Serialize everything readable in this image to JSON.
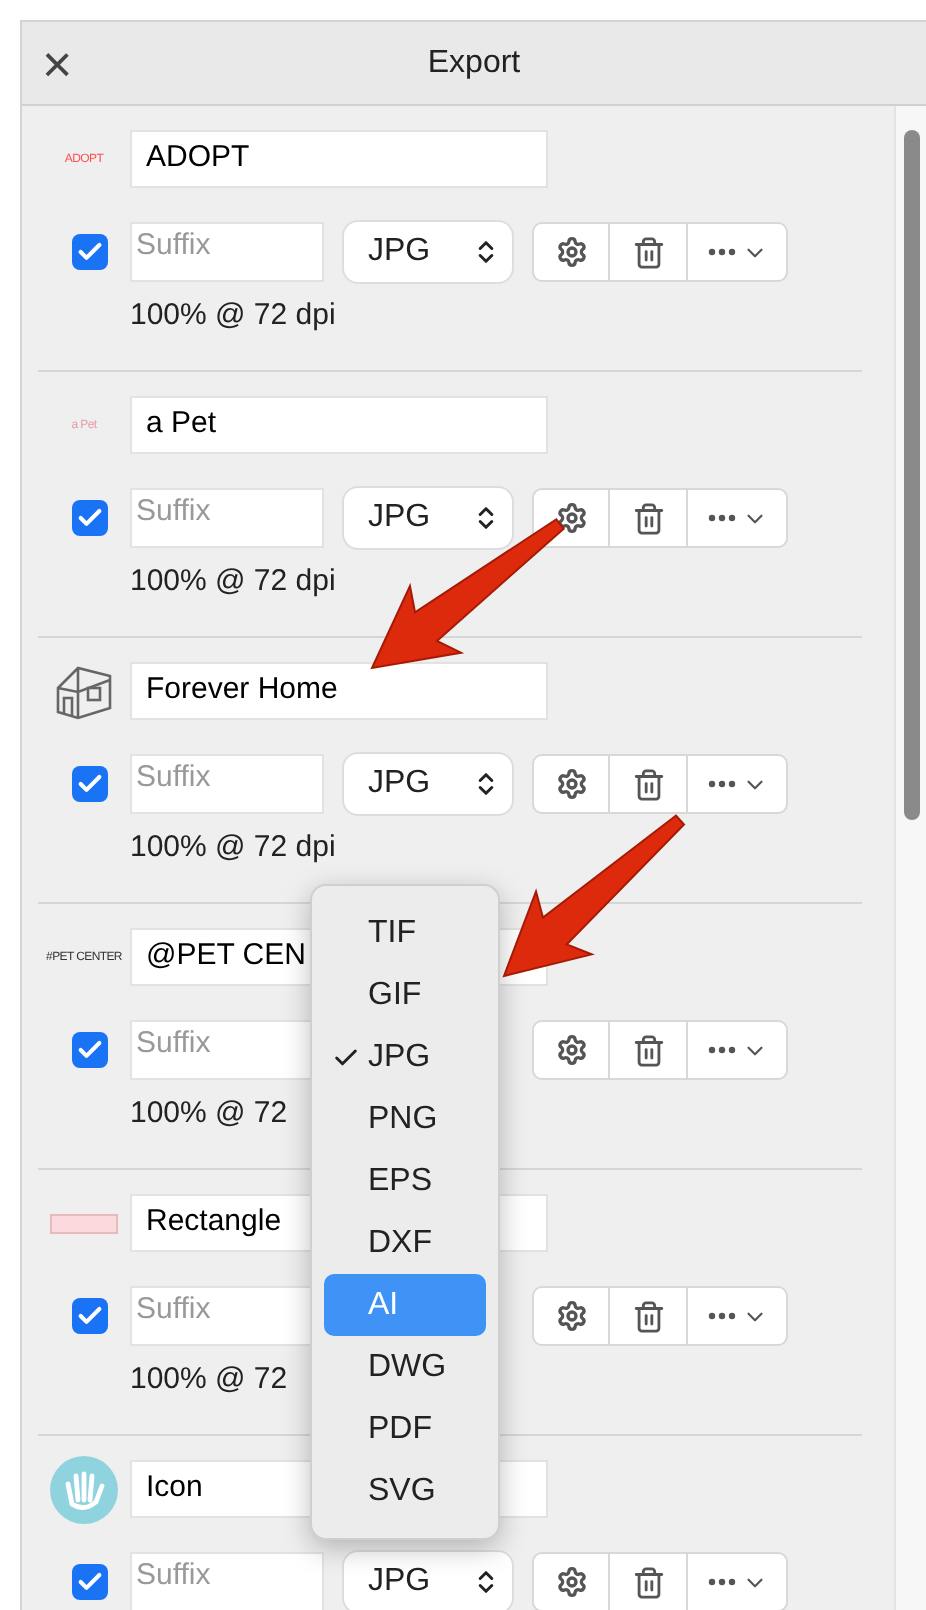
{
  "window": {
    "title": "Export",
    "close": "×"
  },
  "exports": [
    {
      "thumbnail": {
        "kind": "text",
        "text": "ADOPT",
        "color": "#ff4d4d"
      },
      "name": "ADOPT",
      "checked": true,
      "suffix_placeholder": "Suffix",
      "format": "JPG",
      "scale": "100% @ 72 dpi"
    },
    {
      "thumbnail": {
        "kind": "text",
        "text": "a Pet",
        "color": "#e79aa3"
      },
      "name": "a Pet",
      "checked": true,
      "suffix_placeholder": "Suffix",
      "format": "JPG",
      "scale": "100% @ 72 dpi"
    },
    {
      "thumbnail": {
        "kind": "house"
      },
      "name": "Forever Home",
      "checked": true,
      "suffix_placeholder": "Suffix",
      "format": "JPG",
      "scale": "100% @ 72 dpi"
    },
    {
      "thumbnail": {
        "kind": "text",
        "text": "#PET CENTER",
        "color": "#333333"
      },
      "name": "@PET CEN",
      "checked": true,
      "suffix_placeholder": "Suffix",
      "scale": "100% @ 72"
    },
    {
      "thumbnail": {
        "kind": "rect"
      },
      "name": "Rectangle",
      "checked": true,
      "suffix_placeholder": "Suffix",
      "scale": "100% @ 72"
    },
    {
      "thumbnail": {
        "kind": "hand"
      },
      "name": "Icon",
      "checked": true,
      "suffix_placeholder": "Suffix",
      "format": "JPG"
    }
  ],
  "format_menu": {
    "items": [
      {
        "label": "TIF",
        "selected": false,
        "highlighted": false
      },
      {
        "label": "GIF",
        "selected": false,
        "highlighted": false
      },
      {
        "label": "JPG",
        "selected": true,
        "highlighted": false
      },
      {
        "label": "PNG",
        "selected": false,
        "highlighted": false
      },
      {
        "label": "EPS",
        "selected": false,
        "highlighted": false
      },
      {
        "label": "DXF",
        "selected": false,
        "highlighted": false
      },
      {
        "label": "AI",
        "selected": false,
        "highlighted": true
      },
      {
        "label": "DWG",
        "selected": false,
        "highlighted": false
      },
      {
        "label": "PDF",
        "selected": false,
        "highlighted": false
      },
      {
        "label": "SVG",
        "selected": false,
        "highlighted": false
      }
    ]
  }
}
